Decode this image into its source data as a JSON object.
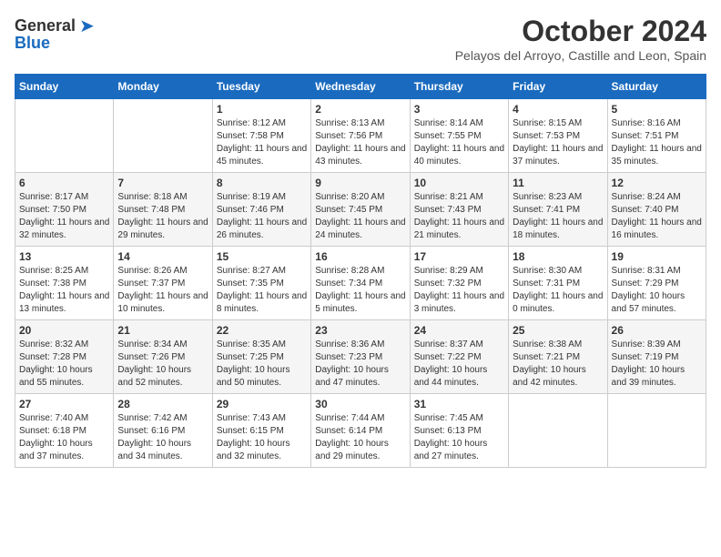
{
  "header": {
    "logo_general": "General",
    "logo_blue": "Blue",
    "month_year": "October 2024",
    "location": "Pelayos del Arroyo, Castille and Leon, Spain"
  },
  "weekdays": [
    "Sunday",
    "Monday",
    "Tuesday",
    "Wednesday",
    "Thursday",
    "Friday",
    "Saturday"
  ],
  "weeks": [
    [
      {
        "day": "",
        "info": ""
      },
      {
        "day": "",
        "info": ""
      },
      {
        "day": "1",
        "info": "Sunrise: 8:12 AM\nSunset: 7:58 PM\nDaylight: 11 hours and 45 minutes."
      },
      {
        "day": "2",
        "info": "Sunrise: 8:13 AM\nSunset: 7:56 PM\nDaylight: 11 hours and 43 minutes."
      },
      {
        "day": "3",
        "info": "Sunrise: 8:14 AM\nSunset: 7:55 PM\nDaylight: 11 hours and 40 minutes."
      },
      {
        "day": "4",
        "info": "Sunrise: 8:15 AM\nSunset: 7:53 PM\nDaylight: 11 hours and 37 minutes."
      },
      {
        "day": "5",
        "info": "Sunrise: 8:16 AM\nSunset: 7:51 PM\nDaylight: 11 hours and 35 minutes."
      }
    ],
    [
      {
        "day": "6",
        "info": "Sunrise: 8:17 AM\nSunset: 7:50 PM\nDaylight: 11 hours and 32 minutes."
      },
      {
        "day": "7",
        "info": "Sunrise: 8:18 AM\nSunset: 7:48 PM\nDaylight: 11 hours and 29 minutes."
      },
      {
        "day": "8",
        "info": "Sunrise: 8:19 AM\nSunset: 7:46 PM\nDaylight: 11 hours and 26 minutes."
      },
      {
        "day": "9",
        "info": "Sunrise: 8:20 AM\nSunset: 7:45 PM\nDaylight: 11 hours and 24 minutes."
      },
      {
        "day": "10",
        "info": "Sunrise: 8:21 AM\nSunset: 7:43 PM\nDaylight: 11 hours and 21 minutes."
      },
      {
        "day": "11",
        "info": "Sunrise: 8:23 AM\nSunset: 7:41 PM\nDaylight: 11 hours and 18 minutes."
      },
      {
        "day": "12",
        "info": "Sunrise: 8:24 AM\nSunset: 7:40 PM\nDaylight: 11 hours and 16 minutes."
      }
    ],
    [
      {
        "day": "13",
        "info": "Sunrise: 8:25 AM\nSunset: 7:38 PM\nDaylight: 11 hours and 13 minutes."
      },
      {
        "day": "14",
        "info": "Sunrise: 8:26 AM\nSunset: 7:37 PM\nDaylight: 11 hours and 10 minutes."
      },
      {
        "day": "15",
        "info": "Sunrise: 8:27 AM\nSunset: 7:35 PM\nDaylight: 11 hours and 8 minutes."
      },
      {
        "day": "16",
        "info": "Sunrise: 8:28 AM\nSunset: 7:34 PM\nDaylight: 11 hours and 5 minutes."
      },
      {
        "day": "17",
        "info": "Sunrise: 8:29 AM\nSunset: 7:32 PM\nDaylight: 11 hours and 3 minutes."
      },
      {
        "day": "18",
        "info": "Sunrise: 8:30 AM\nSunset: 7:31 PM\nDaylight: 11 hours and 0 minutes."
      },
      {
        "day": "19",
        "info": "Sunrise: 8:31 AM\nSunset: 7:29 PM\nDaylight: 10 hours and 57 minutes."
      }
    ],
    [
      {
        "day": "20",
        "info": "Sunrise: 8:32 AM\nSunset: 7:28 PM\nDaylight: 10 hours and 55 minutes."
      },
      {
        "day": "21",
        "info": "Sunrise: 8:34 AM\nSunset: 7:26 PM\nDaylight: 10 hours and 52 minutes."
      },
      {
        "day": "22",
        "info": "Sunrise: 8:35 AM\nSunset: 7:25 PM\nDaylight: 10 hours and 50 minutes."
      },
      {
        "day": "23",
        "info": "Sunrise: 8:36 AM\nSunset: 7:23 PM\nDaylight: 10 hours and 47 minutes."
      },
      {
        "day": "24",
        "info": "Sunrise: 8:37 AM\nSunset: 7:22 PM\nDaylight: 10 hours and 44 minutes."
      },
      {
        "day": "25",
        "info": "Sunrise: 8:38 AM\nSunset: 7:21 PM\nDaylight: 10 hours and 42 minutes."
      },
      {
        "day": "26",
        "info": "Sunrise: 8:39 AM\nSunset: 7:19 PM\nDaylight: 10 hours and 39 minutes."
      }
    ],
    [
      {
        "day": "27",
        "info": "Sunrise: 7:40 AM\nSunset: 6:18 PM\nDaylight: 10 hours and 37 minutes."
      },
      {
        "day": "28",
        "info": "Sunrise: 7:42 AM\nSunset: 6:16 PM\nDaylight: 10 hours and 34 minutes."
      },
      {
        "day": "29",
        "info": "Sunrise: 7:43 AM\nSunset: 6:15 PM\nDaylight: 10 hours and 32 minutes."
      },
      {
        "day": "30",
        "info": "Sunrise: 7:44 AM\nSunset: 6:14 PM\nDaylight: 10 hours and 29 minutes."
      },
      {
        "day": "31",
        "info": "Sunrise: 7:45 AM\nSunset: 6:13 PM\nDaylight: 10 hours and 27 minutes."
      },
      {
        "day": "",
        "info": ""
      },
      {
        "day": "",
        "info": ""
      }
    ]
  ]
}
